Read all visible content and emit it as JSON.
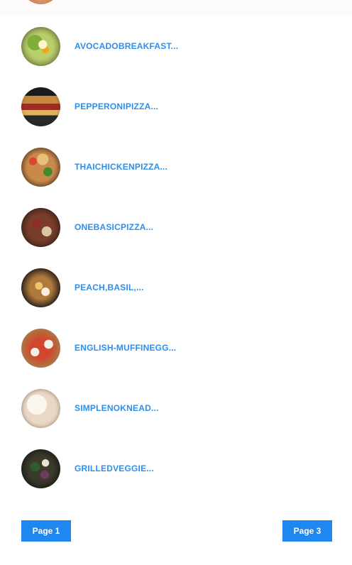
{
  "recipes": [
    {
      "title": "AVOCADOBREAKFAST...",
      "image_icon": "avocado-breakfast-thumbnail"
    },
    {
      "title": "PEPPERONIPIZZA...",
      "image_icon": "pepperoni-pizza-thumbnail"
    },
    {
      "title": "THAICHICKENPIZZA...",
      "image_icon": "thai-chicken-pizza-thumbnail"
    },
    {
      "title": "ONEBASICPIZZA...",
      "image_icon": "one-basic-pizza-thumbnail"
    },
    {
      "title": "PEACH,BASIL,...",
      "image_icon": "peach-basil-thumbnail"
    },
    {
      "title": "ENGLISH-MUFFINEGG...",
      "image_icon": "english-muffin-egg-thumbnail"
    },
    {
      "title": "SIMPLENOKNEAD...",
      "image_icon": "simple-no-knead-thumbnail"
    },
    {
      "title": "GRILLEDVEGGIE...",
      "image_icon": "grilled-veggie-thumbnail"
    }
  ],
  "pagination": {
    "prev_label": "Page 1",
    "next_label": "Page 3"
  },
  "colors": {
    "accent": "#1e88f0",
    "title_text": "#2f8ee8",
    "top_strip": "#fcfbfa"
  }
}
